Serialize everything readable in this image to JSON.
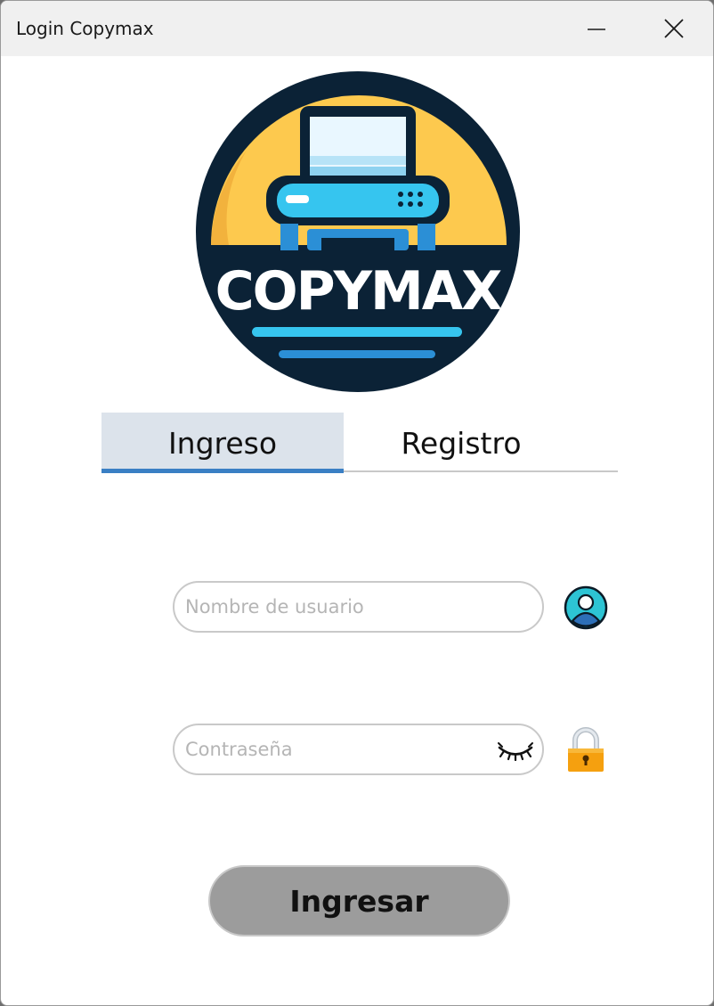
{
  "window": {
    "title": "Login Copymax"
  },
  "logo": {
    "text": "COPYMAX",
    "colors": {
      "circle": "#0b2236",
      "sun": "#fdc94e",
      "printer_body": "#36c5ef",
      "accent_blue": "#2b8fd6"
    }
  },
  "tabs": [
    {
      "label": "Ingreso",
      "active": true
    },
    {
      "label": "Registro",
      "active": false
    }
  ],
  "form": {
    "username": {
      "placeholder": "Nombre de usuario",
      "value": "",
      "icon": "user-icon"
    },
    "password": {
      "placeholder": "Contraseña",
      "value": "",
      "icon": "lock-icon",
      "toggle_icon": "eye-closed-icon"
    },
    "submit_label": "Ingresar"
  },
  "colors": {
    "active_tab_bg": "#dce3eb",
    "active_tab_underline": "#3a7fc4",
    "button_bg": "#9c9c9c",
    "user_icon": "#2dc4d4",
    "lock_icon": "#f5a00f"
  }
}
